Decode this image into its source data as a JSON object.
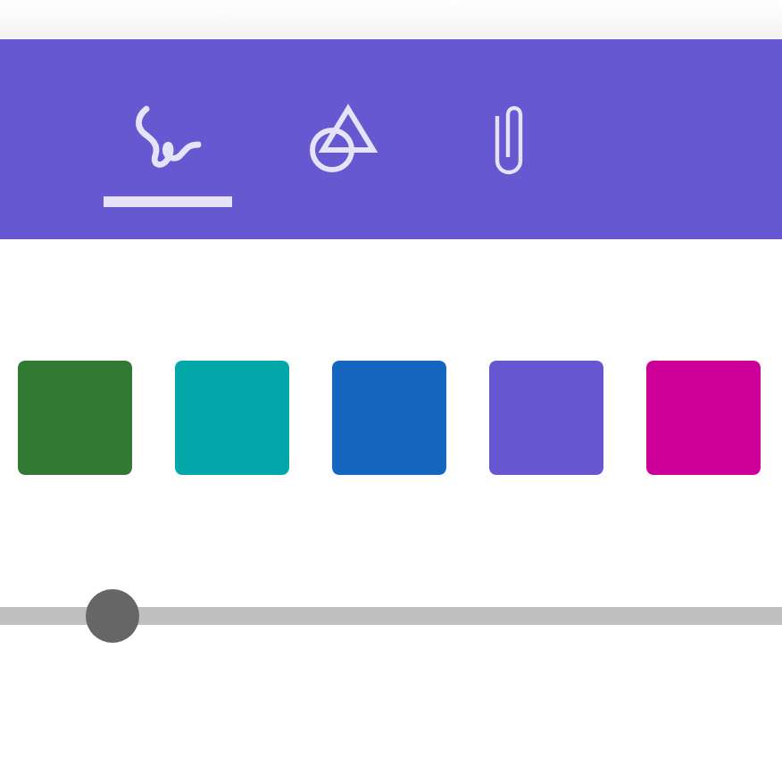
{
  "toolbar": {
    "tabs": [
      {
        "kind": "ink",
        "selected": true
      },
      {
        "kind": "shapes",
        "selected": false
      },
      {
        "kind": "attach",
        "selected": false
      }
    ]
  },
  "swatches": [
    {
      "color": "#327a33"
    },
    {
      "color": "#05a8aa"
    },
    {
      "color": "#1666bf"
    },
    {
      "color": "#6657d0"
    },
    {
      "color": "#cc0099"
    }
  ],
  "slider": {
    "level": 0.144
  }
}
